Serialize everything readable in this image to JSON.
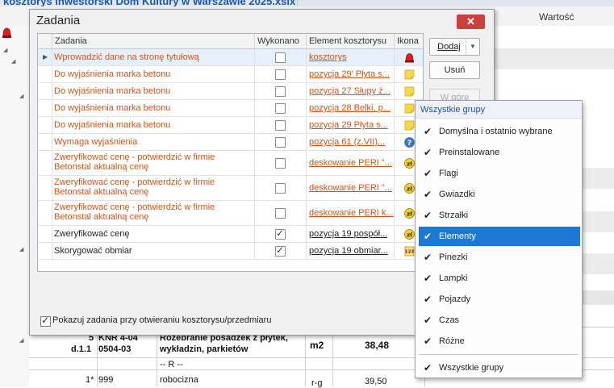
{
  "app": {
    "window_title": "kosztorys inwestorski Dom Kultury w Warszawie 2025.xslx",
    "column_header": "Wartość"
  },
  "dialog": {
    "title": "Zadania",
    "close_glyph": "✕",
    "columns": {
      "task": "Zadania",
      "done": "Wykonano",
      "element": "Element kosztorysu",
      "icon": "Ikona"
    },
    "rows": [
      {
        "task": "Wprowadzić dane na stronę tytułową",
        "done": false,
        "element": "kosztorys",
        "icon": "alarm-lamp-icon",
        "color": "#d0531a"
      },
      {
        "task": "Do wyjaśnienia marka betonu",
        "done": false,
        "element": "pozycja 29' Płyta s...",
        "icon": "sticky-note-icon",
        "color": "#d0531a"
      },
      {
        "task": "Do wyjaśnienia marka betonu",
        "done": false,
        "element": "pozycja 27 Słupy ż...",
        "icon": "sticky-note-icon",
        "color": "#d0531a"
      },
      {
        "task": "Do wyjaśnienia marka betonu",
        "done": false,
        "element": "pozycja 28 Belki, p...",
        "icon": "sticky-note-icon",
        "color": "#d0531a"
      },
      {
        "task": "Do wyjaśnienia marka betonu",
        "done": false,
        "element": "pozycja 29 Płyta s...",
        "icon": "sticky-note-icon",
        "color": "#d0531a"
      },
      {
        "task": "Wymaga wyjaśnienia",
        "done": false,
        "element": "pozycja 61 (z.VII)...",
        "icon": "question-icon",
        "color": "#d0531a"
      },
      {
        "task": "Zweryfikować cenę - potwierdzić w firmie Betonstal aktualną cenę",
        "done": false,
        "element": "deskowanie PERI \"...",
        "icon": "price-coin-icon",
        "color": "#d0531a"
      },
      {
        "task": "Zweryfikować cenę - potwierdzić w firmie Betonstal aktualną cenę",
        "done": false,
        "element": "deskowanie PERI \"...",
        "icon": "price-coin-icon",
        "color": "#d0531a"
      },
      {
        "task": "Zweryfikować cenę - potwierdzić w firmie Betonstal aktualną cenę",
        "done": false,
        "element": "deskowanie PERI k...",
        "icon": "price-coin-icon",
        "color": "#d0531a"
      },
      {
        "task": "Zweryfikować cenę",
        "done": true,
        "element": "pozycja 19 pospół...",
        "icon": "price-coin-icon",
        "color": "#222222"
      },
      {
        "task": "Skorygować obmiar",
        "done": true,
        "element": "pozycja 19 obmiar...",
        "icon": "calculator-icon",
        "color": "#222222"
      }
    ],
    "buttons": {
      "add": "Dodaj",
      "remove": "Usuń",
      "disabled": "W górę"
    },
    "footer_checkbox": {
      "label": "Pokazuj zadania przy otwieraniu kosztorysu/przedmiaru",
      "checked": true
    }
  },
  "menu": {
    "header": "Wszystkie grupy",
    "items": [
      {
        "label": "Domyślna i ostatnio wybrane",
        "checked": true,
        "highlighted": false
      },
      {
        "label": "Preinstalowane",
        "checked": true,
        "highlighted": false
      },
      {
        "label": "Flagi",
        "checked": true,
        "highlighted": false
      },
      {
        "label": "Gwiazdki",
        "checked": true,
        "highlighted": false
      },
      {
        "label": "Strzałki",
        "checked": true,
        "highlighted": false
      },
      {
        "label": "Elementy",
        "checked": true,
        "highlighted": true
      },
      {
        "label": "Pinezki",
        "checked": true,
        "highlighted": false
      },
      {
        "label": "Lampki",
        "checked": true,
        "highlighted": false
      },
      {
        "label": "Pojazdy",
        "checked": true,
        "highlighted": false
      },
      {
        "label": "Czas",
        "checked": true,
        "highlighted": false
      },
      {
        "label": "Różne",
        "checked": true,
        "highlighted": false
      }
    ],
    "footer_item": {
      "label": "Wszystkie grupy",
      "checked": true
    },
    "check_glyph": "✔"
  },
  "background_table": {
    "row1": {
      "num": "5",
      "sub": "d.1.1",
      "code1": "KNR 4-04",
      "code2": "0504-03",
      "desc1": "Rozebranie posadzek z płytek,",
      "desc2": "wykładzin, parkietów",
      "unit": "m2",
      "qty": "38,48"
    },
    "row2": {
      "text": "-- R --"
    },
    "row3": {
      "num": "1*",
      "code": "999",
      "desc": "robocizna",
      "unit": "r-g",
      "qty": "39,50"
    }
  },
  "colors": {
    "accent": "#1d78d4",
    "close_red": "#c9413b",
    "task_orange": "#d0531a"
  }
}
